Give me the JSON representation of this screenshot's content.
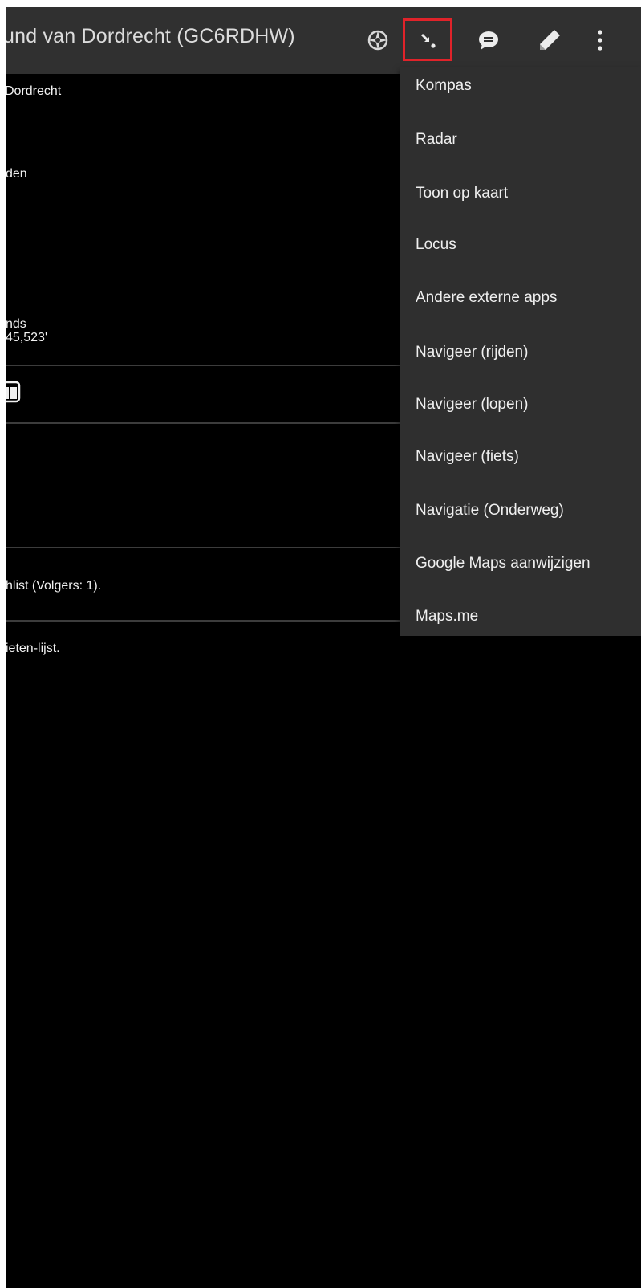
{
  "appbar": {
    "title": "und van Dordrecht (GC6RDHW)",
    "icons": [
      "compass-icon",
      "navigate-icon",
      "chat-bubble-icon",
      "pencil-icon",
      "more-vertical-icon"
    ]
  },
  "background": {
    "line1": "Dordrecht",
    "line2": "den",
    "line3a": "nds",
    "line3b": "45,523'",
    "line4": "hlist (Volgers: 1).",
    "line5": "ieten-lijst."
  },
  "menu": {
    "items": [
      {
        "label": "Kompas"
      },
      {
        "label": "Radar"
      },
      {
        "label": "Toon op kaart"
      },
      {
        "label": "Locus"
      },
      {
        "label": "Andere externe apps"
      },
      {
        "label": "Navigeer (rijden)"
      },
      {
        "label": "Navigeer (lopen)"
      },
      {
        "label": "Navigeer (fiets)"
      },
      {
        "label": "Navigatie (Onderweg)"
      },
      {
        "label": "Google Maps aanwijzigen"
      },
      {
        "label": "Maps.me"
      }
    ]
  },
  "colors": {
    "appbar": "#303030",
    "menu_bg": "#2f2f2f",
    "highlight": "#e0232a",
    "background": "#000000"
  }
}
